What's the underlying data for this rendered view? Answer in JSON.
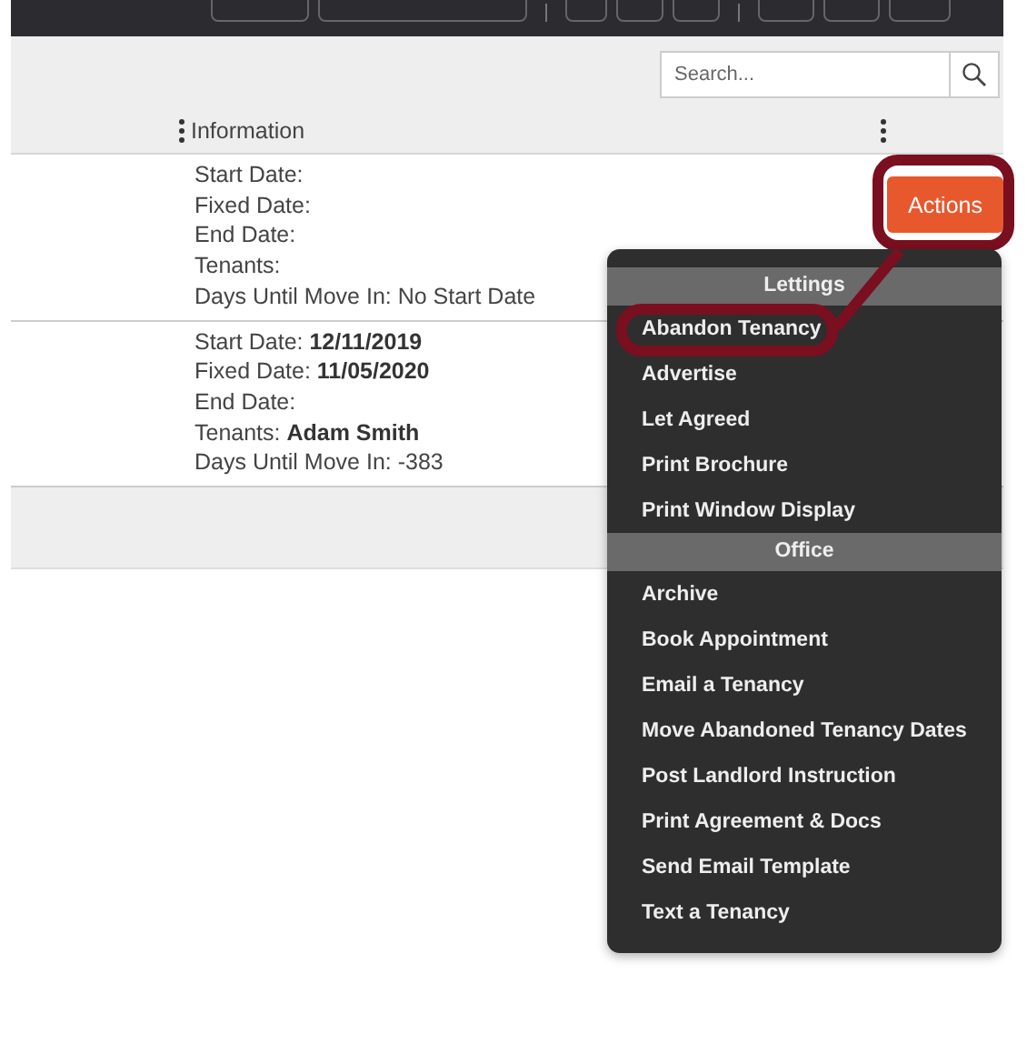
{
  "search": {
    "placeholder": "Search..."
  },
  "table": {
    "columns": [
      {
        "label": "Information"
      }
    ],
    "rows": [
      {
        "lines": [
          "Start Date:",
          "Fixed Date:",
          "End Date:",
          "Tenants:",
          "Days Until Move In: No Start Date"
        ],
        "action": {
          "label": "Actions",
          "highlighted": true
        }
      },
      {
        "lines": [
          "Start Date: **12/11/2019**",
          "Fixed Date: **11/05/2020**",
          "End Date:",
          "Tenants: **Adam Smith**",
          "Days Until Move In: -383"
        ]
      }
    ]
  },
  "actions_menu": {
    "sections": [
      {
        "title": "Lettings",
        "items": [
          {
            "label": "Abandon Tenancy",
            "highlighted": true
          },
          {
            "label": "Advertise",
            "highlighted": false
          },
          {
            "label": "Let Agreed",
            "highlighted": false
          },
          {
            "label": "Print Brochure",
            "highlighted": false
          },
          {
            "label": "Print Window Display",
            "highlighted": false
          }
        ]
      },
      {
        "title": "Office",
        "items": [
          {
            "label": "Archive",
            "highlighted": false
          },
          {
            "label": "Book Appointment",
            "highlighted": false
          },
          {
            "label": "Email a Tenancy",
            "highlighted": false
          },
          {
            "label": "Move Abandoned Tenancy Dates",
            "highlighted": false
          },
          {
            "label": "Post Landlord Instruction",
            "highlighted": false
          },
          {
            "label": "Print Agreement & Docs",
            "highlighted": false
          },
          {
            "label": "Send Email Template",
            "highlighted": false
          },
          {
            "label": "Text a Tenancy",
            "highlighted": false
          }
        ]
      }
    ]
  }
}
